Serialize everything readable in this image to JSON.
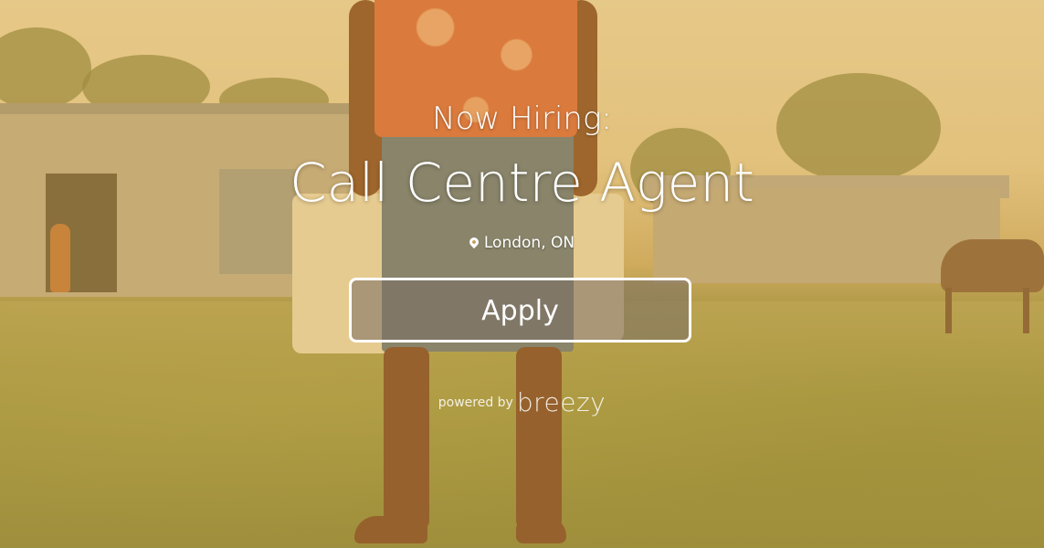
{
  "hero": {
    "kicker": "Now Hiring:",
    "job_title": "Call Centre Agent",
    "location": "London, ON",
    "location_icon": "map-marker-icon",
    "apply_label": "Apply"
  },
  "footer": {
    "powered_by": "powered by",
    "brand": "breezy"
  },
  "colors": {
    "overlay_tint": "#e2b450",
    "text": "#ffffff"
  }
}
